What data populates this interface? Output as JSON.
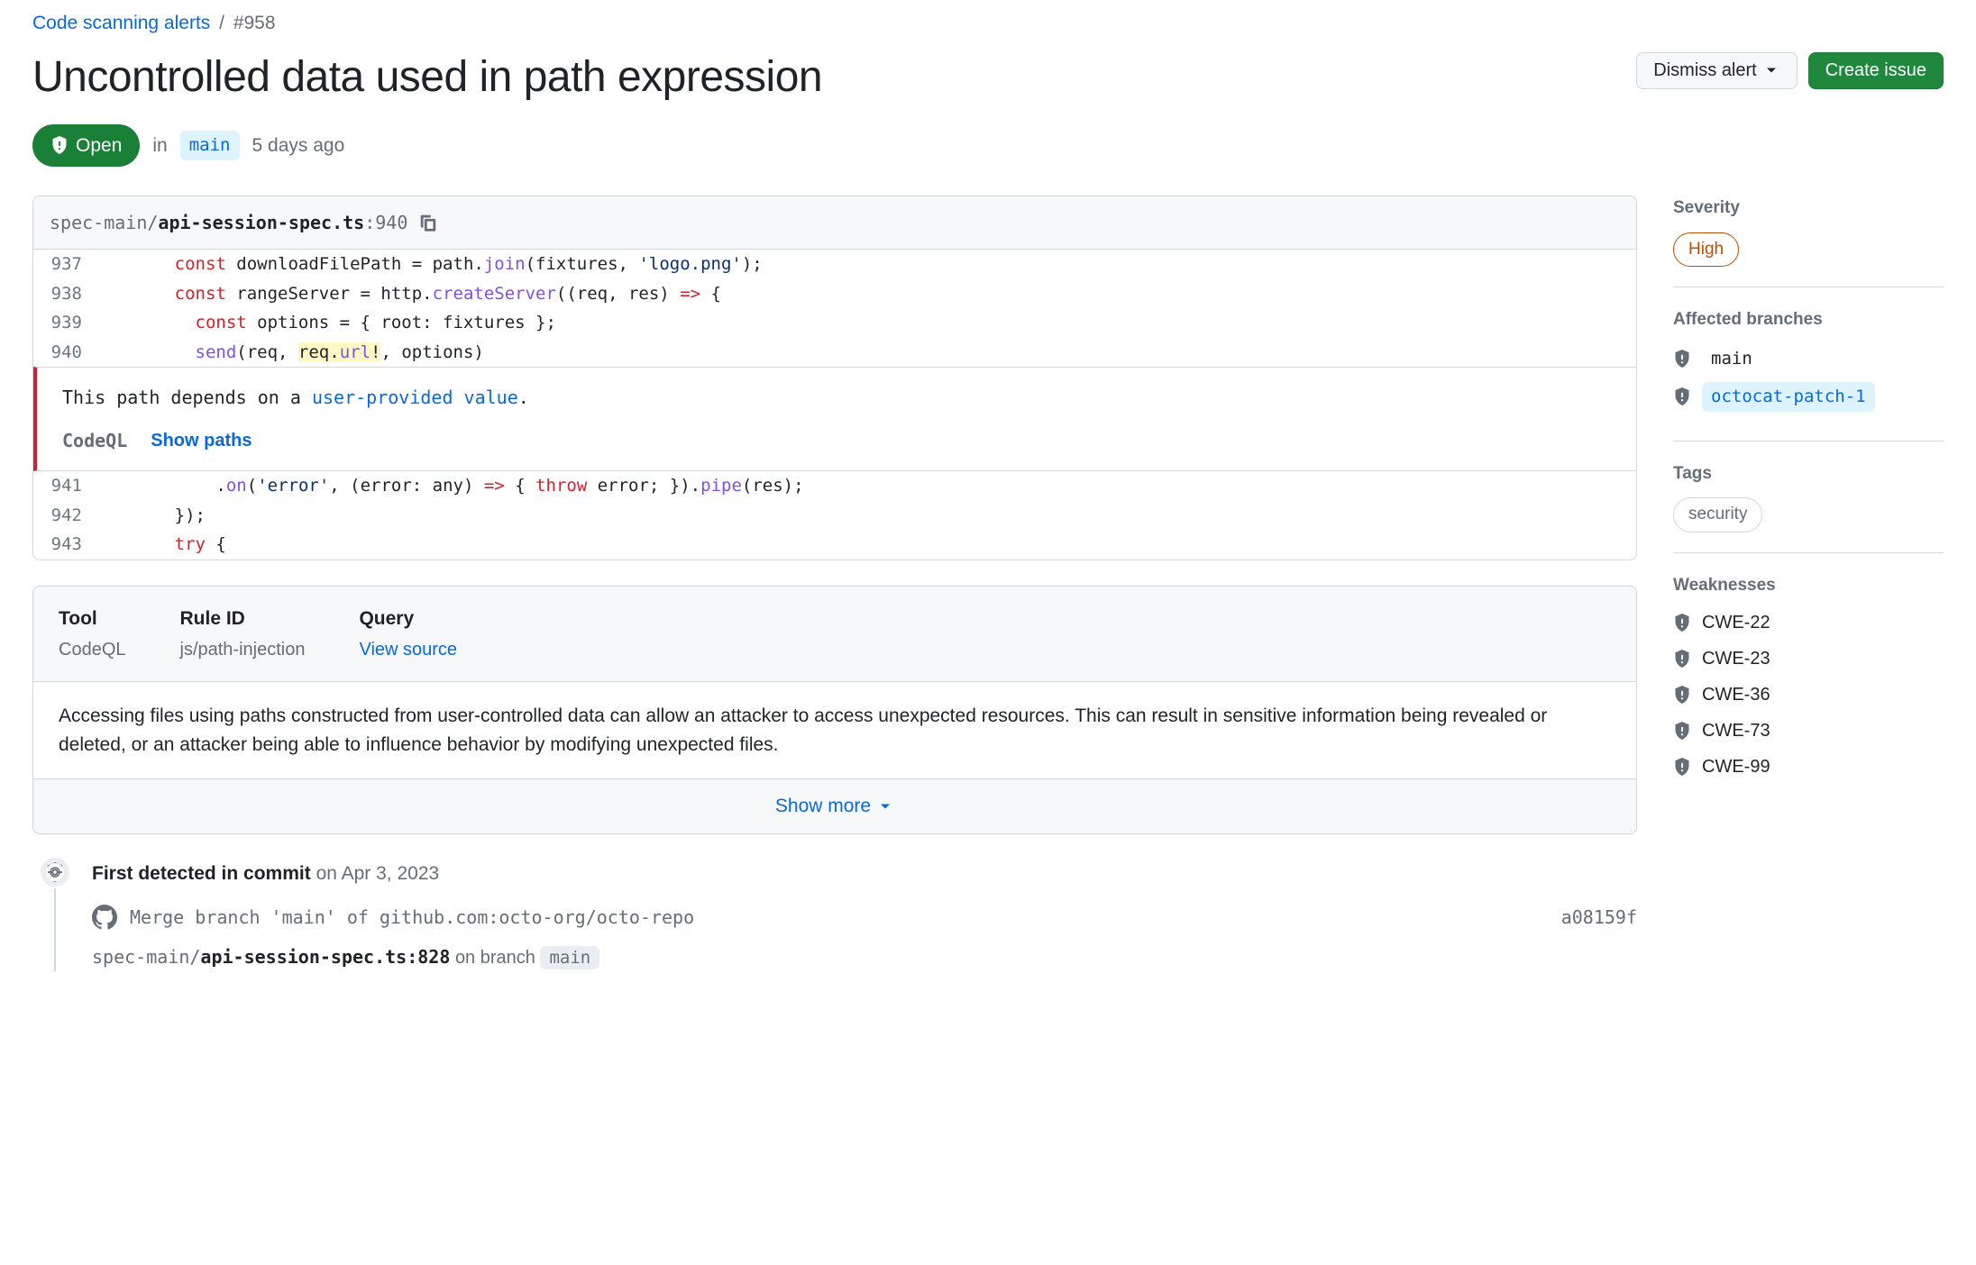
{
  "breadcrumb": {
    "parent": "Code scanning alerts",
    "current": "#958"
  },
  "title": "Uncontrolled data used in path expression",
  "actions": {
    "dismiss": "Dismiss alert",
    "create_issue": "Create issue"
  },
  "status": {
    "state": "Open",
    "in": "in",
    "branch": "main",
    "age": "5 days ago"
  },
  "code_location": {
    "dir": "spec-main/",
    "file": "api-session-spec.ts",
    "line": "940"
  },
  "alert": {
    "message_prefix": "This path depends on a ",
    "message_link": "user-provided value",
    "message_suffix": ".",
    "tool": "CodeQL",
    "show_paths": "Show paths"
  },
  "code_post_lines": [
    "941",
    "942",
    "943"
  ],
  "details": {
    "tool_label": "Tool",
    "tool_val": "CodeQL",
    "rule_label": "Rule ID",
    "rule_val": "js/path-injection",
    "query_label": "Query",
    "query_val": "View source",
    "description": "Accessing files using paths constructed from user-controlled data can allow an attacker to access unexpected resources. This can result in sensitive information being revealed or deleted, or an attacker being able to influence behavior by modifying unexpected files.",
    "show_more": "Show more"
  },
  "timeline": {
    "first_detected": "First detected in commit",
    "first_date": "on Apr 3, 2023",
    "commit_msg": "Merge branch 'main' of github.com:octo-org/octo-repo",
    "commit_sha": "a08159f",
    "file_ref_dir": "spec-main/",
    "file_ref_file": "api-session-spec.ts:828",
    "on_branch_text": " on branch ",
    "on_branch": "main"
  },
  "sidebar": {
    "severity_label": "Severity",
    "severity": "High",
    "branches_label": "Affected branches",
    "branches": [
      {
        "name": "main",
        "active": false
      },
      {
        "name": "octocat-patch-1",
        "active": true
      }
    ],
    "tags_label": "Tags",
    "tags": [
      "security"
    ],
    "weaknesses_label": "Weaknesses",
    "weaknesses": [
      "CWE-22",
      "CWE-23",
      "CWE-36",
      "CWE-73",
      "CWE-99"
    ]
  }
}
